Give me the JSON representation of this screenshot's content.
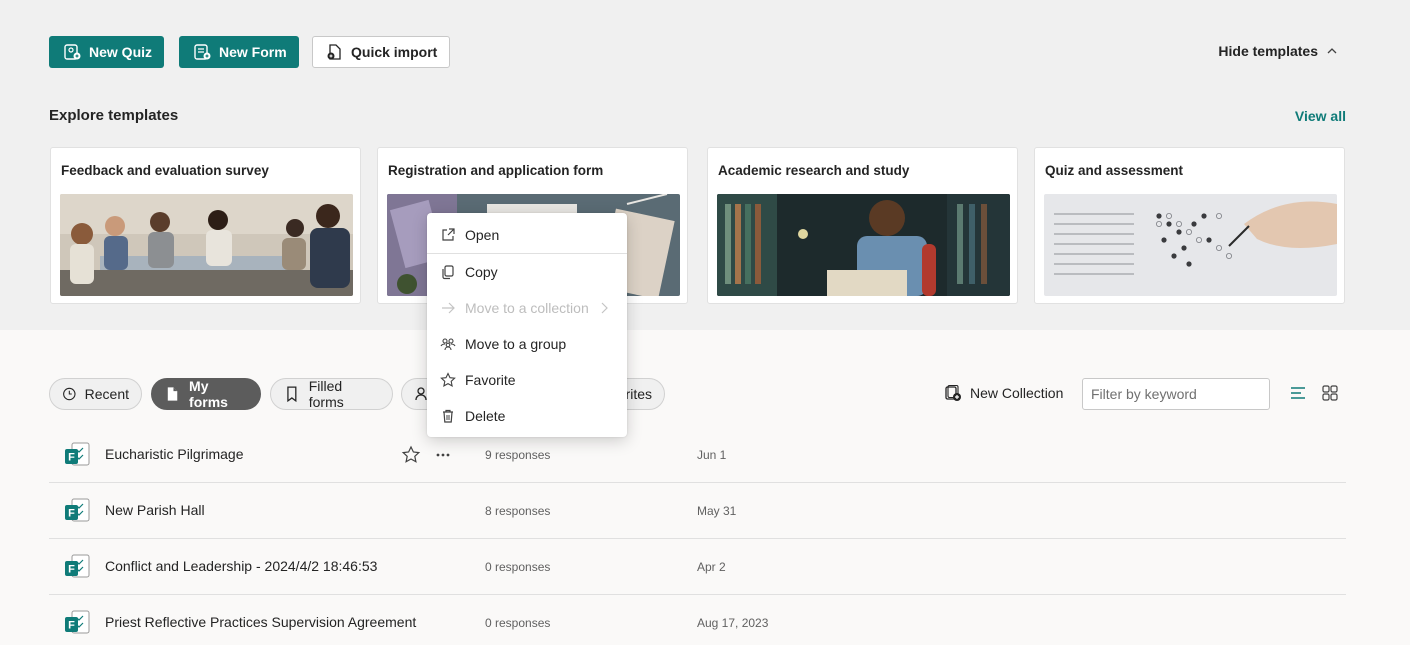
{
  "actions": {
    "new_quiz": "New Quiz",
    "new_form": "New Form",
    "quick_import": "Quick import",
    "hide_templates": "Hide templates"
  },
  "templates": {
    "title": "Explore templates",
    "view_all": "View all",
    "cards": [
      {
        "title": "Feedback and evaluation survey"
      },
      {
        "title": "Registration and application form"
      },
      {
        "title": "Academic research and study"
      },
      {
        "title": "Quiz and assessment"
      }
    ]
  },
  "filters": {
    "recent": "Recent",
    "my_forms": "My forms",
    "filled_forms": "Filled forms",
    "favorites_partial": "rites"
  },
  "toolbar": {
    "new_collection": "New Collection",
    "filter_placeholder": "Filter by keyword"
  },
  "forms": [
    {
      "name": "Eucharistic Pilgrimage",
      "responses": "9 responses",
      "date": "Jun 1"
    },
    {
      "name": "New Parish Hall",
      "responses": "8 responses",
      "date": "May 31"
    },
    {
      "name": "Conflict and Leadership - 2024/4/2 18:46:53",
      "responses": "0 responses",
      "date": "Apr 2"
    },
    {
      "name": "Priest Reflective Practices Supervision Agreement",
      "responses": "0 responses",
      "date": "Aug 17, 2023"
    }
  ],
  "context_menu": {
    "open": "Open",
    "copy": "Copy",
    "move_collection": "Move to a collection",
    "move_group": "Move to a group",
    "favorite": "Favorite",
    "delete": "Delete"
  },
  "colors": {
    "brand": "#0f7b78",
    "active_pill": "#5c5c5c"
  },
  "icons": {
    "forms_app": "forms-file-icon",
    "star": "star-icon",
    "more": "more-horizontal-icon"
  }
}
